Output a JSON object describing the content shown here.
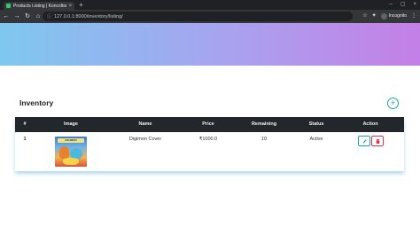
{
  "browser": {
    "tab_title": "Products Listing | Koncoltore",
    "url": "127.0.0.1:8000/inventory/listing/",
    "profile_label": "Incognito"
  },
  "page": {
    "title": "Inventory"
  },
  "table": {
    "headers": [
      "#",
      "Image",
      "Name",
      "Price",
      "Remaining",
      "Status",
      "Action"
    ],
    "rows": [
      {
        "num": "1",
        "image_text": "DIGIMON",
        "name": "Digimon Cover",
        "price": "₹1000.0",
        "remaining": "10",
        "status": "Active"
      }
    ]
  },
  "colors": {
    "header_bg": "#23272b",
    "accent_teal": "#1aa8a2",
    "accent_red": "#e0334b",
    "hero_start": "#7ec8f0",
    "hero_end": "#c47fe6"
  }
}
